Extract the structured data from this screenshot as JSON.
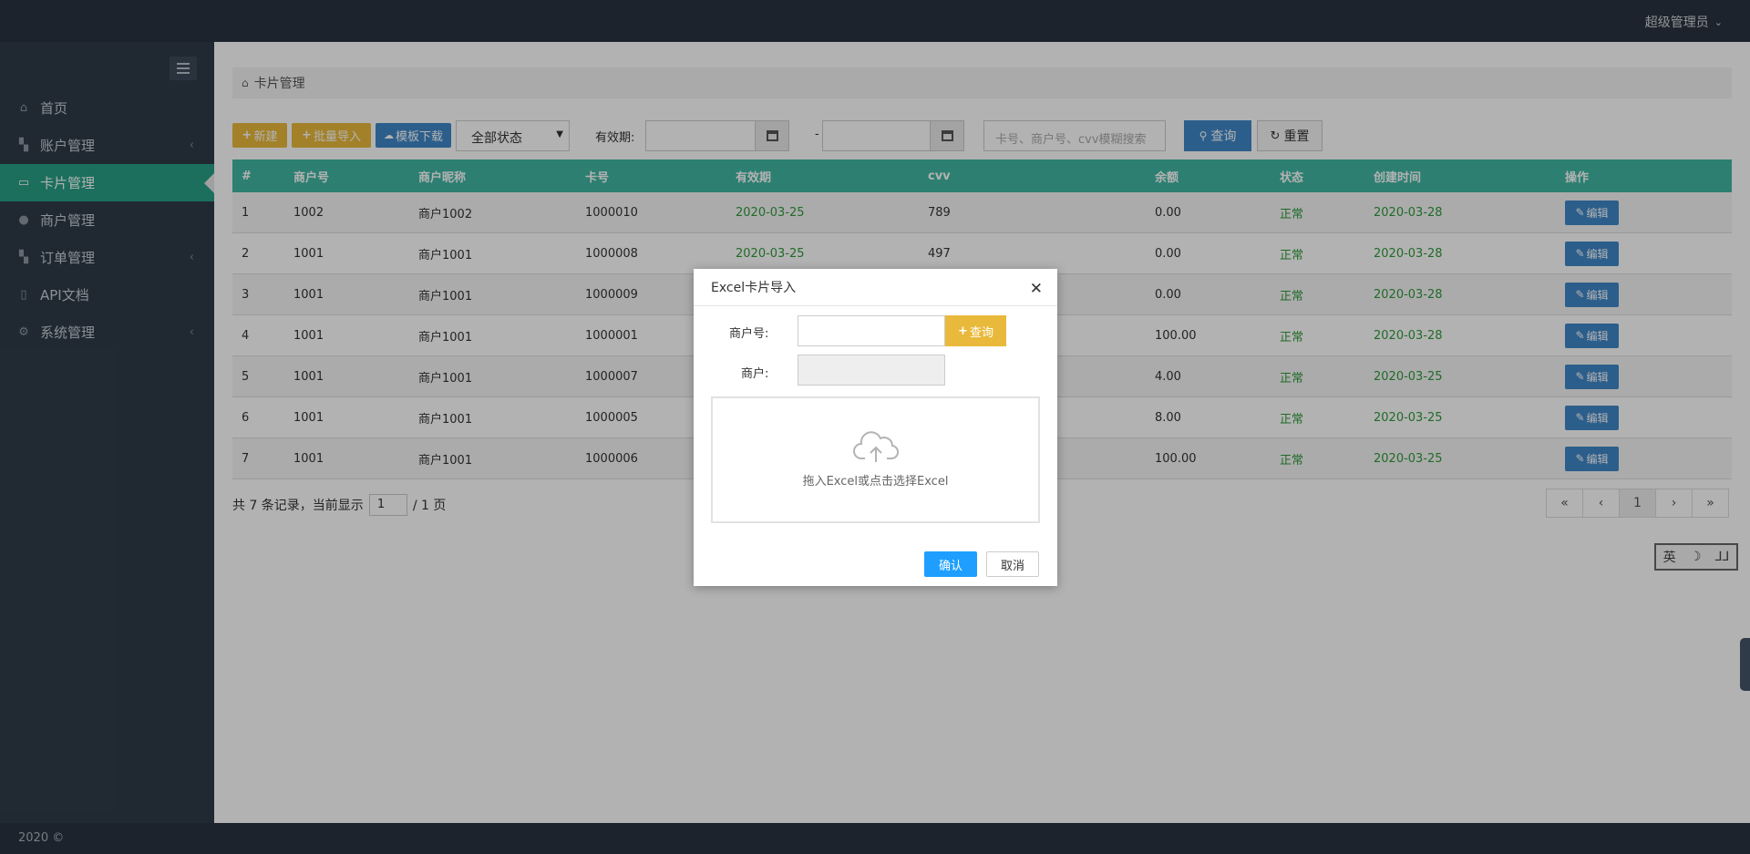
{
  "header": {
    "user": "超级管理员"
  },
  "sidebar": {
    "items": [
      {
        "label": "首页",
        "icon": "home-icon",
        "expandable": false,
        "active": false
      },
      {
        "label": "账户管理",
        "icon": "dashboard-icon",
        "expandable": true,
        "active": false
      },
      {
        "label": "卡片管理",
        "icon": "credit-card-icon",
        "expandable": false,
        "active": true
      },
      {
        "label": "商户管理",
        "icon": "user-icon",
        "expandable": false,
        "active": false
      },
      {
        "label": "订单管理",
        "icon": "dashboard-icon",
        "expandable": true,
        "active": false
      },
      {
        "label": "API文档",
        "icon": "book-icon",
        "expandable": false,
        "active": false
      },
      {
        "label": "系统管理",
        "icon": "gear-icon",
        "expandable": true,
        "active": false
      }
    ]
  },
  "breadcrumb": {
    "label": "卡片管理"
  },
  "toolbar": {
    "new_label": "新建",
    "batch_import_label": "批量导入",
    "template_download_label": "模板下载",
    "status_select": "全部状态",
    "validity_label": "有效期:",
    "date_separator": "-",
    "search_placeholder": "卡号、商户号、cvv模糊搜索",
    "query_label": "查询",
    "reset_label": "重置"
  },
  "table": {
    "headers": [
      "#",
      "商户号",
      "商户昵称",
      "卡号",
      "有效期",
      "cvv",
      "余额",
      "状态",
      "创建时间",
      "操作"
    ],
    "rows": [
      [
        "1",
        "1002",
        "商户1002",
        "1000010",
        "2020-03-25",
        "789",
        "0.00",
        "正常",
        "2020-03-28",
        "编辑"
      ],
      [
        "2",
        "1001",
        "商户1001",
        "1000008",
        "2020-03-25",
        "497",
        "0.00",
        "正常",
        "2020-03-28",
        "编辑"
      ],
      [
        "3",
        "1001",
        "商户1001",
        "1000009",
        "",
        "",
        "0.00",
        "正常",
        "2020-03-28",
        "编辑"
      ],
      [
        "4",
        "1001",
        "商户1001",
        "1000001",
        "",
        "",
        "100.00",
        "正常",
        "2020-03-28",
        "编辑"
      ],
      [
        "5",
        "1001",
        "商户1001",
        "1000007",
        "",
        "",
        "4.00",
        "正常",
        "2020-03-25",
        "编辑"
      ],
      [
        "6",
        "1001",
        "商户1001",
        "1000005",
        "",
        "",
        "8.00",
        "正常",
        "2020-03-25",
        "编辑"
      ],
      [
        "7",
        "1001",
        "商户1001",
        "1000006",
        "",
        "",
        "100.00",
        "正常",
        "2020-03-25",
        "编辑"
      ]
    ]
  },
  "pager": {
    "prefix": "共 7 条记录，当前显示",
    "current": "1",
    "suffix": "/ 1 页",
    "buttons": [
      "«",
      "‹",
      "1",
      "›",
      "»"
    ]
  },
  "ime": {
    "lang": "英",
    "moon": "☽",
    "punct": "⅃⅃"
  },
  "footer": {
    "text": "2020 ©"
  },
  "modal": {
    "title": "Excel卡片导入",
    "merchant_no_label": "商户号:",
    "merchant_label": "商户:",
    "query_label": "查询",
    "dropzone_text": "拖入Excel或点击选择Excel",
    "confirm_label": "确认",
    "cancel_label": "取消"
  },
  "colors": {
    "accent": "#27a085",
    "table_header": "#3fb7a3",
    "primary": "#3f87c7",
    "warning": "#e9b93b",
    "confirm": "#1e9fff",
    "status_green": "#2e9a3a"
  }
}
